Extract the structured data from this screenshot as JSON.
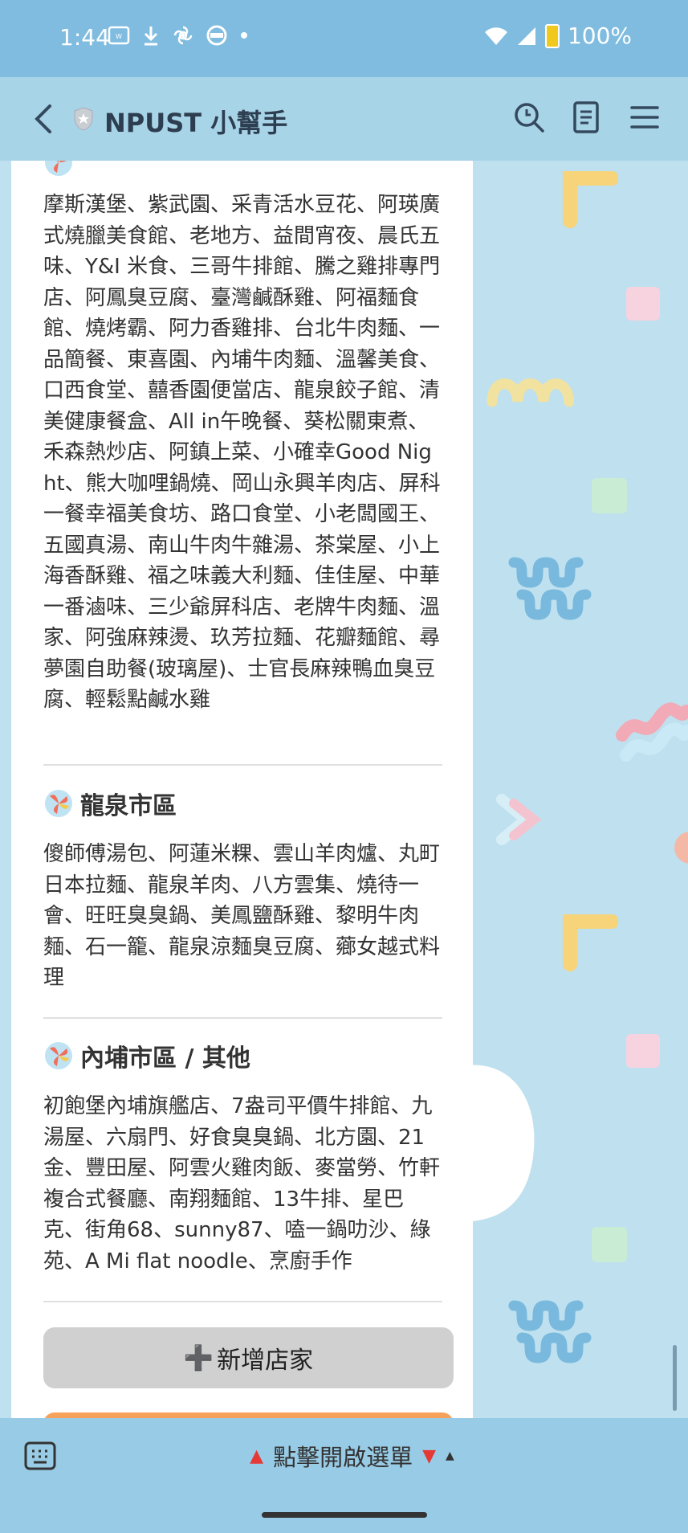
{
  "status_bar": {
    "time": "1:44",
    "battery": "100%",
    "left_icons": [
      "webtoon-icon",
      "download-icon",
      "pinwheel-icon",
      "vpn-icon",
      "dot-icon"
    ],
    "right_icons": [
      "wifi-icon",
      "signal-icon",
      "battery-icon"
    ]
  },
  "header": {
    "title": "NPUST 小幫手",
    "icons": [
      "back-icon",
      "shield-icon",
      "search-icon",
      "notes-icon",
      "menu-icon"
    ]
  },
  "sections": [
    {
      "title": "",
      "text": "摩斯漢堡、紫武園、采青活水豆花、阿瑛廣式燒臘美食館、老地方、益間宵夜、晨氏五味、Y&I 米食、三哥牛排館、騰之雞排專門店、阿鳳臭豆腐、臺灣鹹酥雞、阿福麵食館、燒烤霸、阿力香雞排、台北牛肉麵、一品簡餐、東喜園、內埔牛肉麵、溫馨美食、口西食堂、囍香園便當店、龍泉餃子館、清美健康餐盒、All in午晚餐、葵松關東煮、禾森熱炒店、阿鎮上菜、小確幸Good Night、熊大咖哩鍋燒、岡山永興羊肉店、屏科一餐幸福美食坊、路口食堂、小老闆國王、五國真湯、南山牛肉牛雜湯、茶棠屋、小上海香酥雞、福之味義大利麵、佳佳屋、中華一番滷味、三少爺屏科店、老牌牛肉麵、溫家、阿強麻辣燙、玖芳拉麵、花瓣麵館、尋夢園自助餐(玻璃屋)、士官長麻辣鴨血臭豆腐、輕鬆點鹹水雞"
    },
    {
      "title": "龍泉市區",
      "text": "傻師傅湯包、阿蓮米粿、雲山羊肉爐、丸町日本拉麵、龍泉羊肉、八方雲集、燒待一會、旺旺臭臭鍋、美鳳鹽酥雞、黎明牛肉麵、石一籠、龍泉涼麵臭豆腐、薌女越式料理"
    },
    {
      "title": "內埔市區 / 其他",
      "text": "初飽堡內埔旗艦店、7盎司平價牛排館、九湯屋、六扇門、好食臭臭鍋、北方園、21金、豐田屋、阿雲火雞肉飯、麥當勞、竹軒複合式餐廳、南翔麵館、13牛排、星巴克、街角68、sunny87、嗑一鍋叻沙、綠苑、A Mi flat noodle、烹廚手作"
    }
  ],
  "add_button": {
    "icon": "➕",
    "label": "新增店家"
  },
  "menu_bar": {
    "label": "點擊開啟選單",
    "arrow_left": "▲",
    "arrow_right": "▼",
    "arrow_up": "▲"
  },
  "colors": {
    "status_bar": "#7fbcdf",
    "header": "#a8d4e8",
    "background": "#bfe0ee",
    "menu_bar": "#98cbe5",
    "add_button": "#d0d0d0",
    "orange_button": "#f7a25a"
  }
}
